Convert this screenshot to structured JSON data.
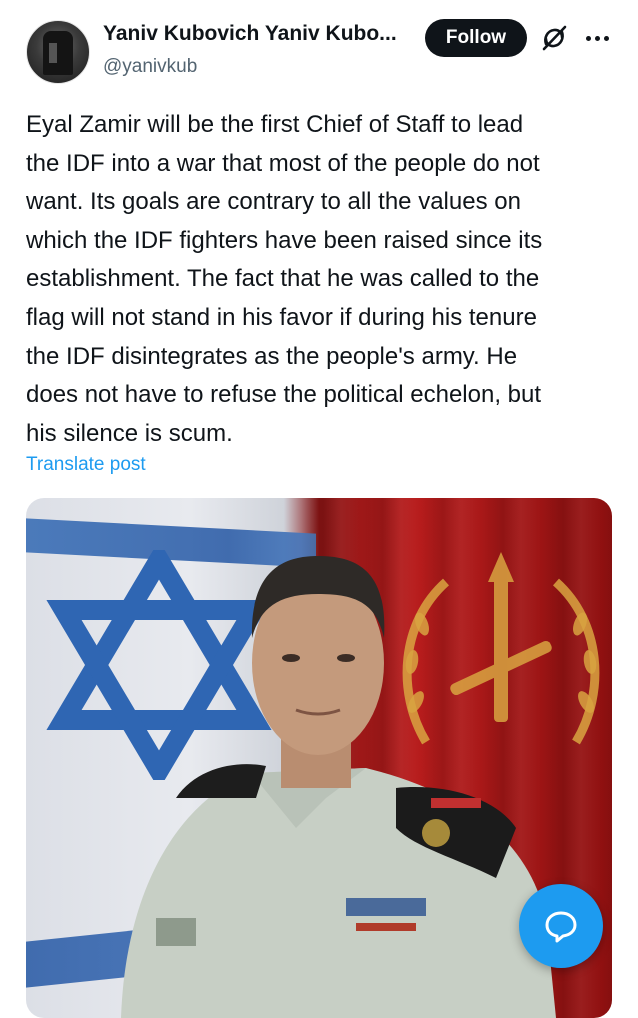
{
  "post": {
    "author_name": "Yaniv Kubovich Yaniv Kubo...",
    "author_handle": "@yanivkub",
    "follow_label": "Follow",
    "text_lines": [
      "Eyal Zamir will be the first Chief of Staff to lead",
      "the IDF into a war that most of the people do not",
      "want. Its goals are contrary to all the values on",
      "which the IDF fighters have been raised since its",
      "establishment. The fact that he was called to the",
      "flag will not stand in his favor if during his tenure",
      "the IDF disintegrates as the people's army. He",
      "does not have to refuse the political echelon, but",
      "his silence is scum."
    ],
    "translate_label": "Translate post"
  },
  "icons": {
    "grok": "grok-icon",
    "more": "more-options-icon",
    "compose": "compose-reply-icon"
  },
  "colors": {
    "accent": "#1d9bf0",
    "text": "#0f1419",
    "secondary_text": "#536471",
    "follow_bg": "#0f1419"
  }
}
